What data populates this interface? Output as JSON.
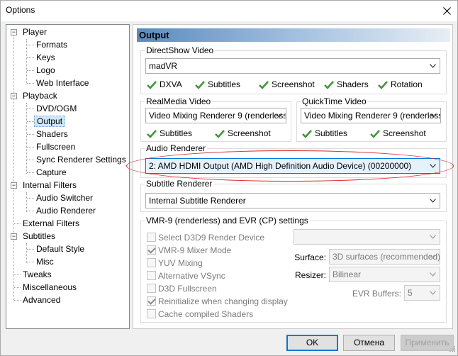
{
  "window": {
    "title": "Options"
  },
  "tree": {
    "player": "Player",
    "formats": "Formats",
    "keys": "Keys",
    "logo": "Logo",
    "web_interface": "Web Interface",
    "playback": "Playback",
    "dvd_ogm": "DVD/OGM",
    "output": "Output",
    "shaders": "Shaders",
    "fullscreen": "Fullscreen",
    "sync_renderer": "Sync Renderer Settings",
    "capture": "Capture",
    "internal_filters": "Internal Filters",
    "audio_switcher": "Audio Switcher",
    "audio_renderer": "Audio Renderer",
    "external_filters": "External Filters",
    "subtitles": "Subtitles",
    "default_style": "Default Style",
    "misc": "Misc",
    "tweaks": "Tweaks",
    "miscellaneous": "Miscellaneous",
    "advanced": "Advanced"
  },
  "page": {
    "title": "Output"
  },
  "directshow": {
    "legend": "DirectShow Video",
    "value": "madVR",
    "caps": [
      "DXVA",
      "Subtitles",
      "Screenshot",
      "Shaders",
      "Rotation"
    ]
  },
  "realmedia": {
    "legend": "RealMedia Video",
    "value": "Video Mixing Renderer 9 (renderless",
    "caps": [
      "Subtitles",
      "Screenshot"
    ]
  },
  "quicktime": {
    "legend": "QuickTime Video",
    "value": "Video Mixing Renderer 9 (renderless",
    "caps": [
      "Subtitles",
      "Screenshot"
    ]
  },
  "audio": {
    "legend": "Audio Renderer",
    "value": "2: AMD HDMI Output (AMD High Definition Audio Device) (00200000)"
  },
  "subtitle": {
    "legend": "Subtitle Renderer",
    "value": "Internal Subtitle Renderer"
  },
  "vmr": {
    "legend": "VMR-9 (renderless) and EVR (CP) settings",
    "options": [
      {
        "label": "Select D3D9 Render Device",
        "checked": false
      },
      {
        "label": "VMR-9 Mixer Mode",
        "checked": true
      },
      {
        "label": "YUV Mixing",
        "checked": false
      },
      {
        "label": "Alternative VSync",
        "checked": false
      },
      {
        "label": "D3D Fullscreen",
        "checked": false
      },
      {
        "label": "Reinitialize when changing display",
        "checked": true
      },
      {
        "label": "Cache compiled Shaders",
        "checked": false
      }
    ],
    "device_value": "",
    "surface_label": "Surface:",
    "surface_value": "3D surfaces (recommended)",
    "resizer_label": "Resizer:",
    "resizer_value": "Bilinear",
    "evr_label": "EVR Buffers:",
    "evr_value": "5"
  },
  "buttons": {
    "ok": "OK",
    "cancel": "Отмена",
    "apply": "Применить"
  },
  "colors": {
    "check_green": "#3c9a35",
    "highlight_ring": "#d9262b",
    "selection": "#cce8ff"
  }
}
